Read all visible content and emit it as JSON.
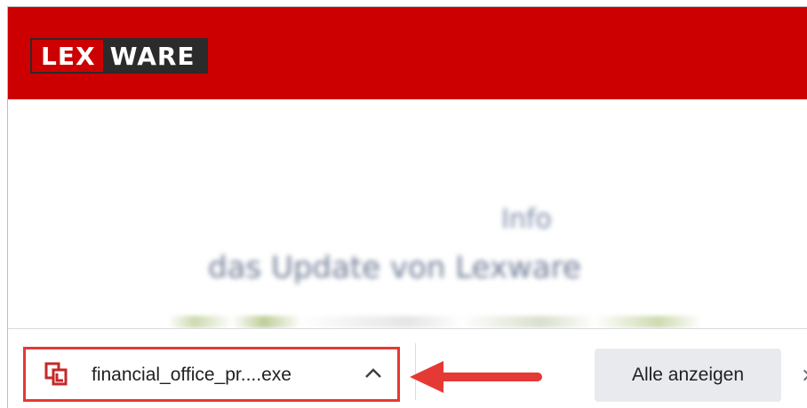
{
  "header": {
    "logo_left": "LEX",
    "logo_right": "WARE",
    "brand_color": "#cc0000"
  },
  "content": {
    "blurred_line1": "Info",
    "blurred_line2": "das Update von Lexware"
  },
  "download_bar": {
    "file_name": "financial_office_pr....exe",
    "file_icon": "lexware-file-icon",
    "chevron_icon": "chevron-up-icon",
    "show_all_label": "Alle anzeigen",
    "close_icon": "close-icon",
    "close_glyph": "×",
    "highlight_color": "#e53935",
    "arrow_icon": "left-arrow-icon"
  }
}
